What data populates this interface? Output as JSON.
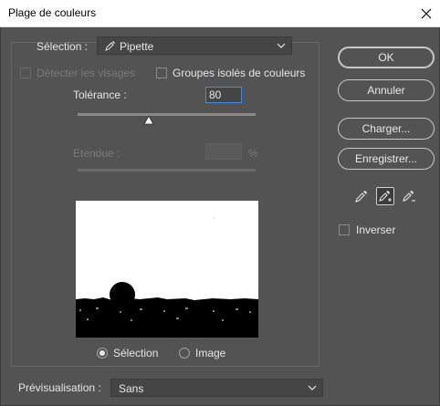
{
  "window": {
    "title": "Plage de couleurs"
  },
  "selection": {
    "label": "Sélection :",
    "value": "Pipette",
    "icon": "eyedropper-icon"
  },
  "options": {
    "detect_faces": {
      "label": "Détecter les visages",
      "checked": false,
      "enabled": false
    },
    "localized_clusters": {
      "label": "Groupes isolés de couleurs",
      "checked": false,
      "enabled": true
    }
  },
  "tolerance": {
    "label": "Tolérance :",
    "value": "80",
    "fraction": 0.4
  },
  "range": {
    "label": "Etendue :",
    "value": "",
    "unit": "%",
    "enabled": false
  },
  "preview_mode": {
    "options": [
      "Sélection",
      "Image"
    ],
    "selected": "Sélection"
  },
  "buttons": {
    "ok": "OK",
    "cancel": "Annuler",
    "load": "Charger...",
    "save": "Enregistrer..."
  },
  "invert": {
    "label": "Inverser",
    "checked": false
  },
  "preview_bottom": {
    "label": "Prévisualisation :",
    "value": "Sans"
  },
  "tools": [
    "eyedropper-icon",
    "eyedropper-plus-icon",
    "eyedropper-minus-icon"
  ],
  "colors": {
    "background": "#535353",
    "accent": "#3d8ee0"
  }
}
